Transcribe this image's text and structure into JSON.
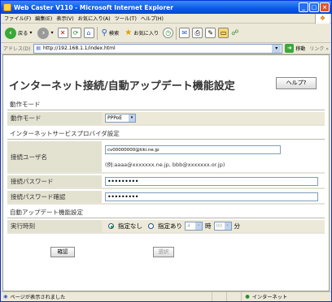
{
  "window": {
    "title": "Web Caster V110 - Microsoft Internet Explorer",
    "min_label": "_",
    "max_label": "□",
    "close_label": "×"
  },
  "menu": [
    "ファイル(F)",
    "編集(E)",
    "表示(V)",
    "お気に入り(A)",
    "ツール(T)",
    "ヘルプ(H)"
  ],
  "toolbar": {
    "back_label": "戻る",
    "search_label": "検索",
    "favorites_label": "お気に入り"
  },
  "address": {
    "label": "アドレス(D)",
    "url": "http://192.168.1.1/index.html",
    "go_label": "移動",
    "links_label": "リンク »"
  },
  "page": {
    "title": "インターネット接続/自動アップデート機能設定",
    "help_button": "ヘルプ?",
    "sections": {
      "mode": "動作モード",
      "isp": "インターネットサービスプロバイダ設定",
      "autoupdate": "自動アップデート機能設定"
    },
    "mode_row": {
      "label": "動作モード",
      "value": "PPPoE"
    },
    "user_row": {
      "label": "接続ユーザ名",
      "value": "cv00000000@tiki.ne.jp",
      "hint": "(例:aaaa@xxxxxxx.ne.jp, bbb@xxxxxxx.or.jp)"
    },
    "pass_row": {
      "label": "接続パスワード",
      "value": "•••••••••"
    },
    "pass_confirm_row": {
      "label": "接続パスワード確認",
      "value": "•••••••••"
    },
    "time_row": {
      "label": "実行時刻",
      "option_none": "指定なし",
      "option_set": "指定あり",
      "hour_value": "4",
      "hour_unit": "時",
      "minute_value": "00",
      "minute_unit": "分"
    },
    "confirm_button": "確認",
    "select_button": "選択"
  },
  "status": {
    "text": "ページが表示されました",
    "zone": "インターネット"
  }
}
